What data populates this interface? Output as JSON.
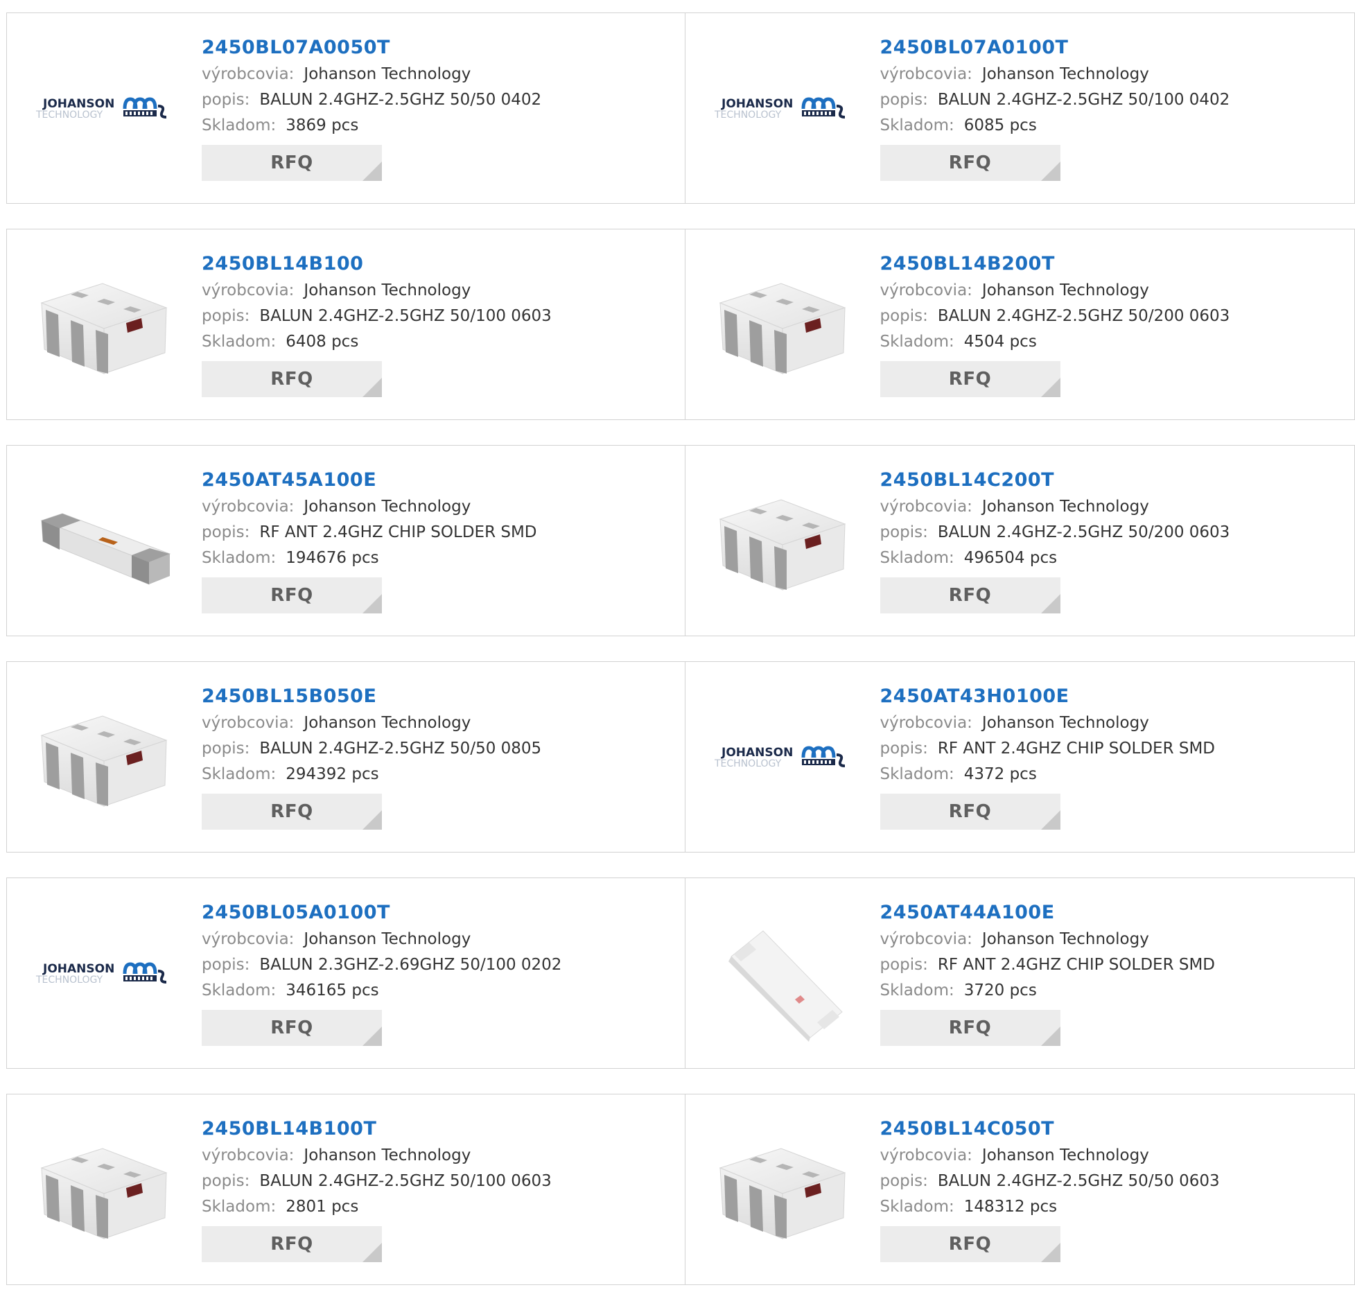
{
  "labels": {
    "manufacturer": "výrobcovia:",
    "description": "popis:",
    "stock": "Skladom:",
    "rfq": "RFQ"
  },
  "logo": {
    "top": "JOHANSON",
    "bottom": "TECHNOLOGY"
  },
  "products": [
    {
      "pn": "2450BL07A0050T",
      "manufacturer": "Johanson Technology",
      "description": "BALUN 2.4GHZ-2.5GHZ 50/50 0402",
      "stock": "3869 pcs",
      "image": "johanson-logo"
    },
    {
      "pn": "2450BL07A0100T",
      "manufacturer": "Johanson Technology",
      "description": "BALUN 2.4GHZ-2.5GHZ 50/100 0402",
      "stock": "6085 pcs",
      "image": "johanson-logo"
    },
    {
      "pn": "2450BL14B100",
      "manufacturer": "Johanson Technology",
      "description": "BALUN 2.4GHZ-2.5GHZ 50/100 0603",
      "stock": "6408 pcs",
      "image": "balun-chip"
    },
    {
      "pn": "2450BL14B200T",
      "manufacturer": "Johanson Technology",
      "description": "BALUN 2.4GHZ-2.5GHZ 50/200 0603",
      "stock": "4504 pcs",
      "image": "balun-chip"
    },
    {
      "pn": "2450AT45A100E",
      "manufacturer": "Johanson Technology",
      "description": "RF ANT 2.4GHZ CHIP SOLDER SMD",
      "stock": "194676 pcs",
      "image": "antenna-chip"
    },
    {
      "pn": "2450BL14C200T",
      "manufacturer": "Johanson Technology",
      "description": "BALUN 2.4GHZ-2.5GHZ 50/200 0603",
      "stock": "496504 pcs",
      "image": "balun-chip"
    },
    {
      "pn": "2450BL15B050E",
      "manufacturer": "Johanson Technology",
      "description": "BALUN 2.4GHZ-2.5GHZ 50/50 0805",
      "stock": "294392 pcs",
      "image": "balun-chip"
    },
    {
      "pn": "2450AT43H0100E",
      "manufacturer": "Johanson Technology",
      "description": "RF ANT 2.4GHZ CHIP SOLDER SMD",
      "stock": "4372 pcs",
      "image": "johanson-logo"
    },
    {
      "pn": "2450BL05A0100T",
      "manufacturer": "Johanson Technology",
      "description": "BALUN 2.3GHZ-2.69GHZ 50/100 0202",
      "stock": "346165 pcs",
      "image": "johanson-logo"
    },
    {
      "pn": "2450AT44A100E",
      "manufacturer": "Johanson Technology",
      "description": "RF ANT 2.4GHZ CHIP SOLDER SMD",
      "stock": "3720 pcs",
      "image": "white-antenna-chip"
    },
    {
      "pn": "2450BL14B100T",
      "manufacturer": "Johanson Technology",
      "description": "BALUN 2.4GHZ-2.5GHZ 50/100 0603",
      "stock": "2801 pcs",
      "image": "balun-chip"
    },
    {
      "pn": "2450BL14C050T",
      "manufacturer": "Johanson Technology",
      "description": "BALUN 2.4GHZ-2.5GHZ 50/50 0603",
      "stock": "148312 pcs",
      "image": "balun-chip"
    }
  ],
  "colors": {
    "link": "#1d6fc0",
    "label": "#8a8a8a",
    "button_bg": "#ececec",
    "border": "#d2d2d2"
  }
}
